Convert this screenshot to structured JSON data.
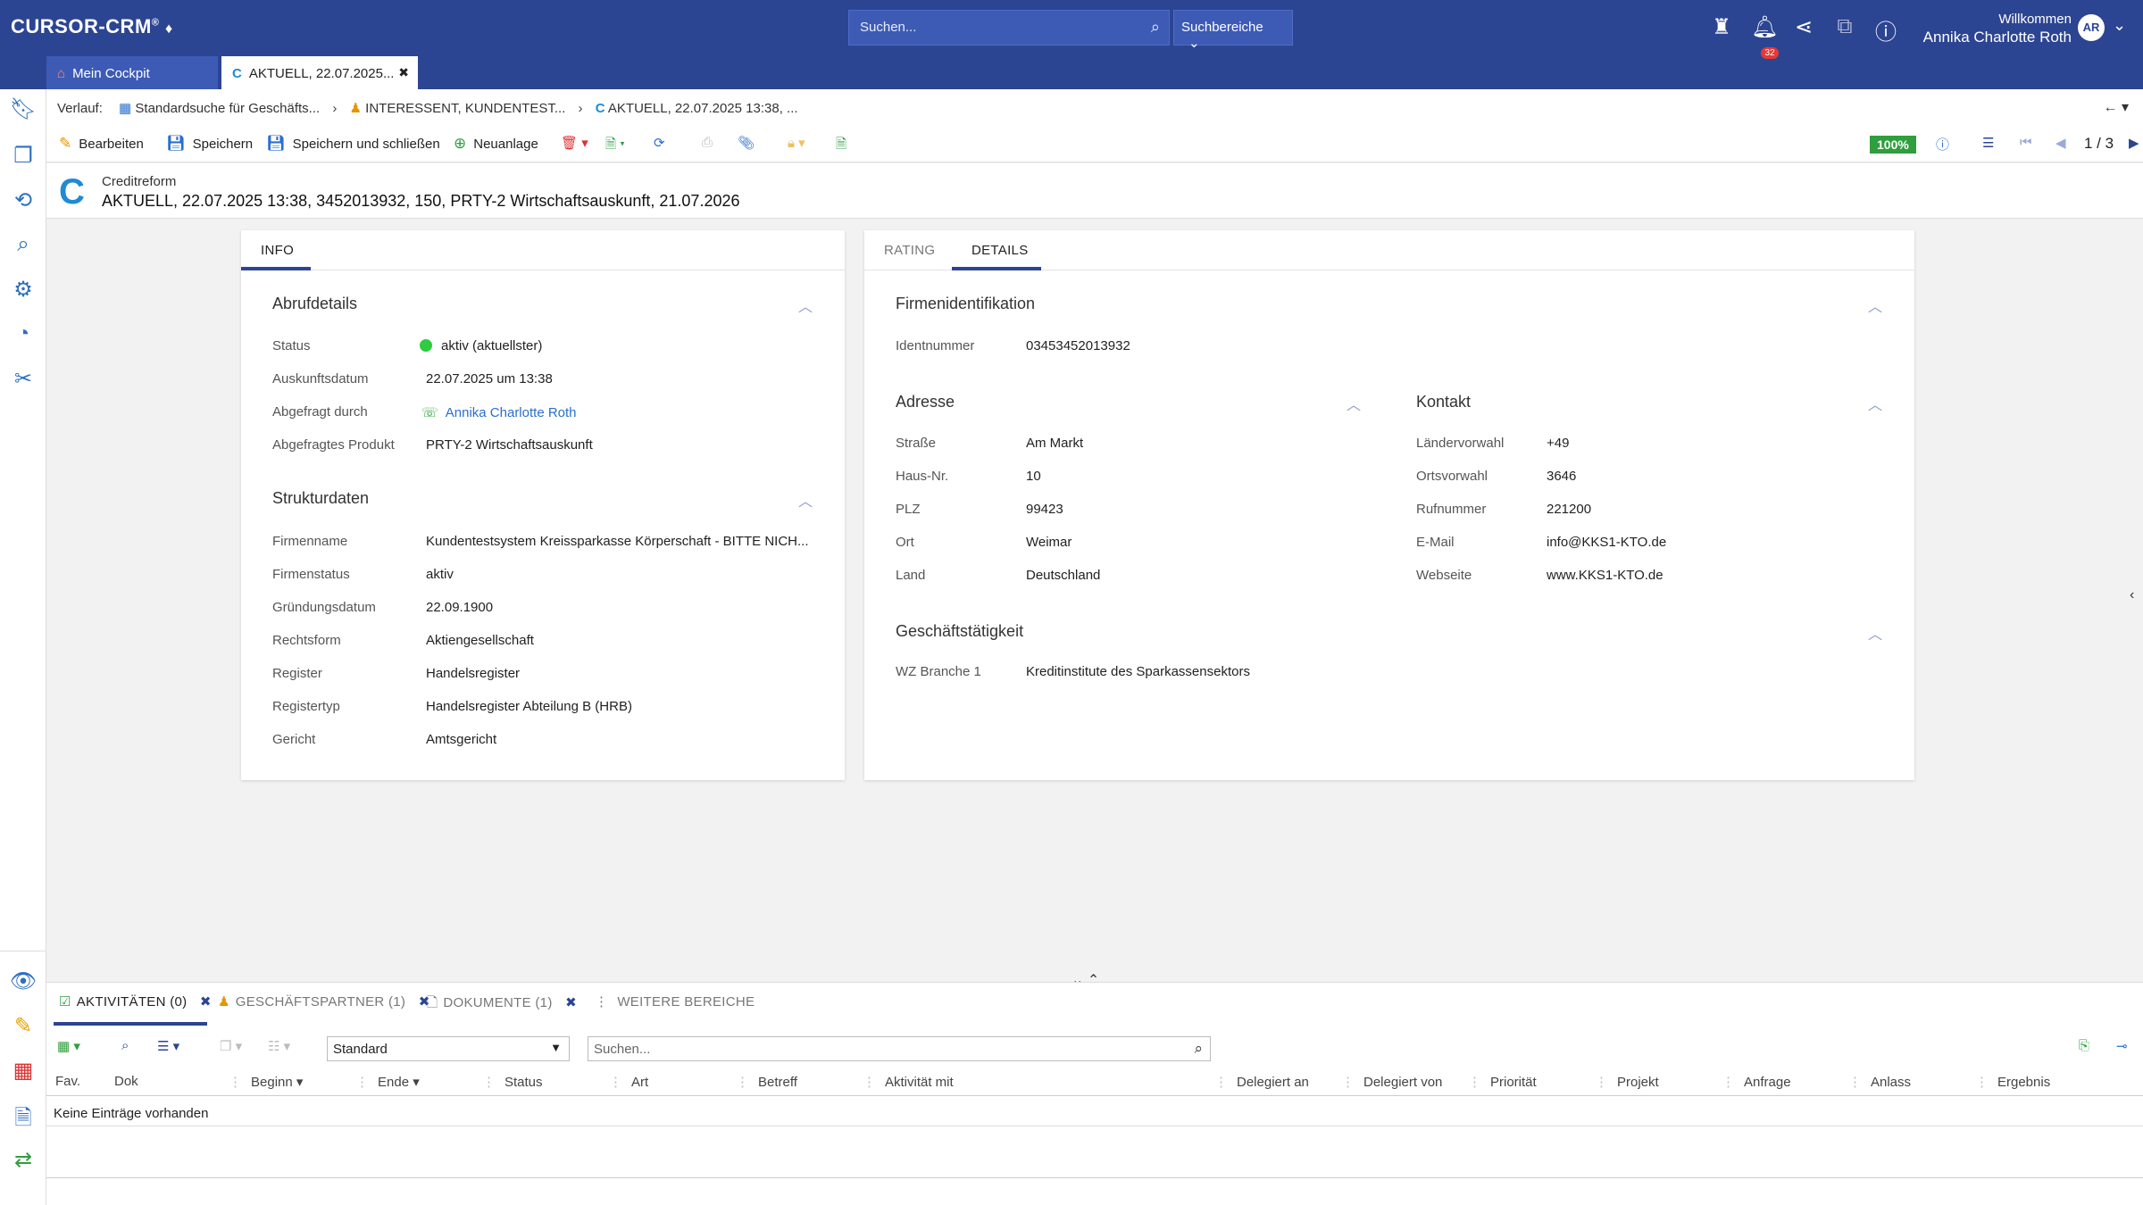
{
  "app": {
    "logo": "CURSOR-CRM"
  },
  "topbar": {
    "search_placeholder": "Suchen...",
    "search_areas_label": "Suchbereiche",
    "notification_count": "32",
    "welcome_label": "Willkommen",
    "user_name": "Annika Charlotte Roth",
    "user_initials": "AR"
  },
  "tabs": {
    "cockpit": "Mein Cockpit",
    "active": "AKTUELL, 22.07.2025..."
  },
  "breadcrumb": {
    "label": "Verlauf:",
    "items": [
      "Standardsuche für Geschäfts...",
      "INTERESSENT, KUNDENTEST...",
      "AKTUELL, 22.07.2025 13:38, ..."
    ]
  },
  "toolbar": {
    "edit": "Bearbeiten",
    "save": "Speichern",
    "save_close": "Speichern und schließen",
    "new": "Neuanlage",
    "zoom": "100%",
    "pager": "1 / 3"
  },
  "record": {
    "subtitle": "Creditreform",
    "title": "AKTUELL, 22.07.2025 13:38, 3452013932, 150, PRTY-2 Wirtschaftsauskunft, 21.07.2026"
  },
  "left_panel": {
    "tab": "INFO",
    "abruf": {
      "title": "Abrufdetails",
      "status_label": "Status",
      "status_value": "aktiv (aktuellster)",
      "date_label": "Auskunftsdatum",
      "date_value": "22.07.2025 um 13:38",
      "by_label": "Abgefragt durch",
      "by_value": "Annika Charlotte Roth",
      "product_label": "Abgefragtes Produkt",
      "product_value": "PRTY-2 Wirtschaftsauskunft"
    },
    "struktur": {
      "title": "Strukturdaten",
      "rows": [
        {
          "label": "Firmenname",
          "value": "Kundentestsystem Kreissparkasse Körperschaft - BITTE NICH..."
        },
        {
          "label": "Firmenstatus",
          "value": "aktiv"
        },
        {
          "label": "Gründungsdatum",
          "value": "22.09.1900"
        },
        {
          "label": "Rechtsform",
          "value": "Aktiengesellschaft"
        },
        {
          "label": "Register",
          "value": "Handelsregister"
        },
        {
          "label": "Registertyp",
          "value": "Handelsregister Abteilung B (HRB)"
        },
        {
          "label": "Gericht",
          "value": "Amtsgericht"
        }
      ]
    }
  },
  "right_panel": {
    "tab_rating": "RATING",
    "tab_details": "DETAILS",
    "firma": {
      "title": "Firmenidentifikation",
      "id_label": "Identnummer",
      "id_value": "03453452013932"
    },
    "adresse": {
      "title": "Adresse",
      "rows": [
        {
          "label": "Straße",
          "value": "Am Markt"
        },
        {
          "label": "Haus-Nr.",
          "value": "10"
        },
        {
          "label": "PLZ",
          "value": "99423"
        },
        {
          "label": "Ort",
          "value": "Weimar"
        },
        {
          "label": "Land",
          "value": "Deutschland"
        }
      ]
    },
    "kontakt": {
      "title": "Kontakt",
      "rows": [
        {
          "label": "Ländervorwahl",
          "value": "+49"
        },
        {
          "label": "Ortsvorwahl",
          "value": "3646"
        },
        {
          "label": "Rufnummer",
          "value": "221200"
        },
        {
          "label": "E-Mail",
          "value": "info@KKS1-KTO.de"
        },
        {
          "label": "Webseite",
          "value": "www.KKS1-KTO.de"
        }
      ]
    },
    "geschaeft": {
      "title": "Geschäftstätigkeit",
      "wz_label": "WZ Branche 1",
      "wz_value": "Kreditinstitute des Sparkassensektors"
    }
  },
  "bottom": {
    "tabs": [
      "AKTIVITÄTEN (0)",
      "GESCHÄFTSPARTNER (1)",
      "DOKUMENTE (1)",
      "WEITERE BEREICHE"
    ],
    "view_select": "Standard",
    "search_placeholder": "Suchen...",
    "columns": [
      "Fav.",
      "Dok",
      "Beginn",
      "Ende",
      "Status",
      "Art",
      "Betreff",
      "Aktivität mit",
      "Delegiert an",
      "Delegiert von",
      "Priorität",
      "Projekt",
      "Anfrage",
      "Anlass",
      "Ergebnis"
    ],
    "empty_text": "Keine Einträge vorhanden"
  }
}
